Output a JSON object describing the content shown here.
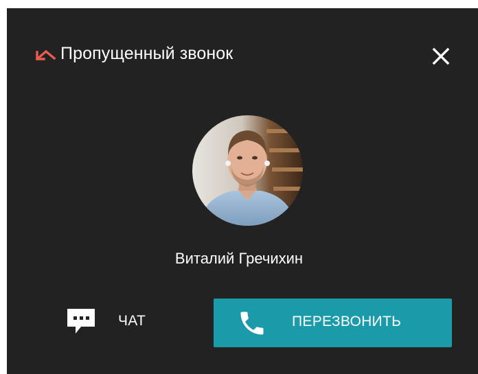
{
  "dialog": {
    "title": "Пропущенный звонок",
    "caller_name": "Виталий Гречихин",
    "missed_icon": "missed-call-icon",
    "close_icon": "close-icon"
  },
  "actions": {
    "chat_label": "ЧАТ",
    "chat_icon": "chat-bubble-icon",
    "callback_label": "ПЕРЕЗВОНИТЬ",
    "callback_icon": "phone-icon"
  },
  "colors": {
    "panel_background": "#222222",
    "accent": "#1b9aaa",
    "missed_icon": "#e95c4f",
    "text": "#ffffff"
  }
}
